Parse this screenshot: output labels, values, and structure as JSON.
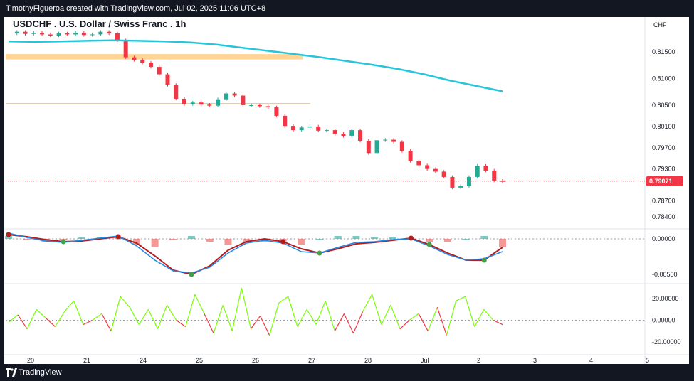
{
  "header": {
    "caption": "TimothyFigueroa created with TradingView.com, Jul 02, 2025 11:06 UTC+8"
  },
  "footer": {
    "brand": "TradingView"
  },
  "colors": {
    "up": "#22ab94",
    "down": "#f23645",
    "ma": "#26c6da",
    "zone": "#ffb74d",
    "macd_line": "#1e88e5",
    "signal_up": "#43a047",
    "signal_down": "#b71c1c",
    "osc_up": "#76ff03",
    "osc_down": "#f23645",
    "price_tag": "#f23645"
  },
  "chart_data": {
    "type": "candlestick",
    "title": "USDCHF . U.S. Dollar / Swiss Franc . 1h",
    "currency": "CHF",
    "last_price": "0.79071",
    "price_axis": {
      "ticks": [
        "0.81500",
        "0.81000",
        "0.80500",
        "0.80100",
        "0.79700",
        "0.79300",
        "0.78700",
        "0.78400"
      ],
      "range": [
        0.782,
        0.8205
      ]
    },
    "macd_axis": {
      "ticks": [
        "0.00000",
        "-0.00500"
      ]
    },
    "osc_axis": {
      "ticks": [
        "20.00000",
        "0.00000",
        "-20.00000"
      ]
    },
    "x_labels": [
      "20",
      "21",
      "24",
      "25",
      "26",
      "27",
      "28",
      "Jul",
      "2",
      "3",
      "4",
      "5"
    ],
    "price_path": [
      0.8185,
      0.8188,
      0.8184,
      0.8186,
      0.8183,
      0.8181,
      0.8185,
      0.8183,
      0.8186,
      0.8182,
      0.8183,
      0.8188,
      0.8185,
      0.8172,
      0.814,
      0.8135,
      0.813,
      0.8122,
      0.8108,
      0.8088,
      0.8062,
      0.8052,
      0.8055,
      0.8051,
      0.8049,
      0.8061,
      0.8072,
      0.8068,
      0.805,
      0.805,
      0.8048,
      0.8046,
      0.803,
      0.8011,
      0.8003,
      0.8008,
      0.801,
      0.8002,
      0.8003,
      0.7996,
      0.7992,
      0.8003,
      0.7983,
      0.796,
      0.7984,
      0.7985,
      0.7981,
      0.7964,
      0.7945,
      0.7937,
      0.793,
      0.7925,
      0.7915,
      0.7895,
      0.7898,
      0.7915,
      0.7936,
      0.7927,
      0.7908,
      0.7906
    ],
    "ma_path": [
      0.817,
      0.8169,
      0.817,
      0.8171,
      0.8172,
      0.8171,
      0.817,
      0.8168,
      0.8164,
      0.8158,
      0.8152,
      0.8146,
      0.814,
      0.8133,
      0.8126,
      0.8118,
      0.8108,
      0.8096,
      0.8086,
      0.8076
    ],
    "resistance_zone": [
      0.8136,
      0.8146
    ],
    "support_line": 0.8053,
    "macd_line": [
      0.0008,
      0.0002,
      -0.0003,
      -0.0005,
      -0.0002,
      0.0001,
      0.0004,
      -0.001,
      -0.003,
      -0.0045,
      -0.0048,
      -0.004,
      -0.002,
      -0.0006,
      -0.0002,
      -0.0006,
      -0.0018,
      -0.002,
      -0.0012,
      -0.0005,
      -0.0004,
      -0.0001,
      0.0,
      -0.001,
      -0.0022,
      -0.003,
      -0.0028,
      -0.0018
    ],
    "signal_line": [
      0.0006,
      0.0003,
      -0.0001,
      -0.0004,
      -0.0003,
      0.0,
      0.0003,
      -0.0006,
      -0.0024,
      -0.0044,
      -0.005,
      -0.0038,
      -0.0016,
      -0.0004,
      0.0,
      -0.0004,
      -0.0014,
      -0.002,
      -0.0014,
      -0.0007,
      -0.0005,
      -0.0002,
      0.0001,
      -0.0008,
      -0.002,
      -0.003,
      -0.003,
      -0.0012
    ],
    "osc_values": [
      -2,
      5,
      -8,
      10,
      2,
      -6,
      8,
      18,
      -4,
      0,
      6,
      -10,
      22,
      12,
      -4,
      10,
      -8,
      14,
      0,
      -6,
      24,
      6,
      -12,
      14,
      -10,
      30,
      -8,
      4,
      -14,
      16,
      22,
      -6,
      10,
      -4,
      18,
      -10,
      6,
      -12,
      8,
      24,
      -4,
      14,
      -8,
      0,
      6,
      -10,
      12,
      -14,
      18,
      22,
      -6,
      10,
      0,
      -4
    ],
    "crossovers": [
      {
        "i": 0,
        "dir": "down"
      },
      {
        "i": 3,
        "dir": "up"
      },
      {
        "i": 6,
        "dir": "down"
      },
      {
        "i": 10,
        "dir": "up"
      },
      {
        "i": 15,
        "dir": "down"
      },
      {
        "i": 17,
        "dir": "up"
      },
      {
        "i": 22,
        "dir": "down"
      },
      {
        "i": 23,
        "dir": "up"
      },
      {
        "i": 26,
        "dir": "up"
      }
    ]
  }
}
